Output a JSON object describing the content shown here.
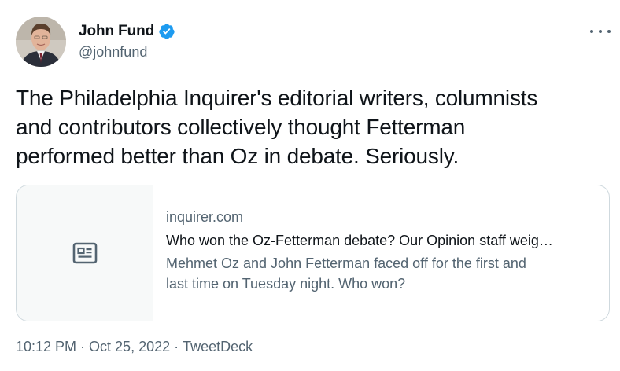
{
  "author": {
    "display_name": "John Fund",
    "handle": "@johnfund",
    "avatar_icon": "profile-photo",
    "verified_icon": "verified-badge-icon",
    "verified_color": "#1d9bf0"
  },
  "menu_icon": "more-horizontal-icon",
  "tweet": {
    "line1": "The Philadelphia Inquirer's editorial writers, columnists",
    "line2": "and contributors collectively thought Fetterman",
    "line3": "performed better than Oz in debate. Seriously."
  },
  "card": {
    "media_icon": "article-icon",
    "domain": "inquirer.com",
    "title": "Who won the Oz-Fetterman debate? Our Opinion staff weig…",
    "desc_line1": "Mehmet Oz and John Fetterman faced off for the first and",
    "desc_line2": "last time on Tuesday night. Who won?"
  },
  "meta": {
    "time": "10:12 PM",
    "separator": " · ",
    "date": "Oct 25, 2022",
    "source": "TweetDeck"
  }
}
